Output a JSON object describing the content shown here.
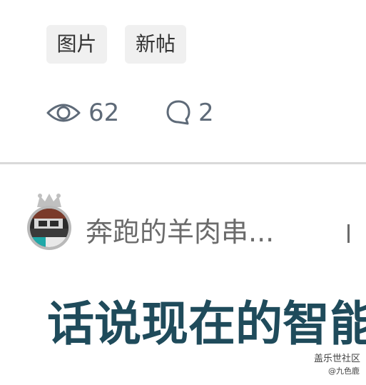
{
  "tags": [
    "图片",
    "新帖"
  ],
  "stats": {
    "views": "62",
    "comments": "2"
  },
  "post": {
    "author": "奔跑的羊肉串...",
    "title": "话说现在的智能"
  },
  "watermark": {
    "line1": "盖乐世社区",
    "line2": "@九色鹿"
  },
  "icons": {
    "views": "eye-icon",
    "comments": "comment-bubble-icon",
    "badge": "crown-icon"
  },
  "colors": {
    "tag_bg": "#f0f0f0",
    "stat_text": "#5e6a78",
    "title": "#1f4b5b",
    "author": "#6b6b6b"
  }
}
